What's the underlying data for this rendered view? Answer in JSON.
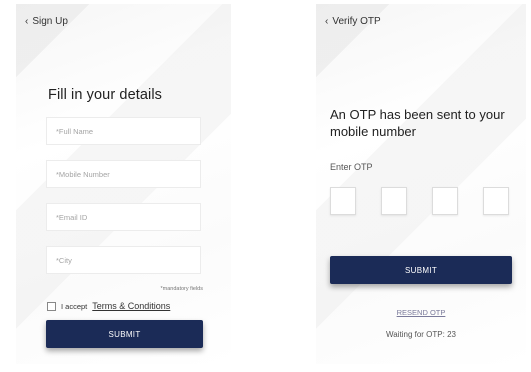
{
  "signup": {
    "back_label": "Sign Up",
    "title": "Fill in your details",
    "fields": {
      "full_name_placeholder": "*Full Name",
      "mobile_placeholder": "*Mobile Number",
      "email_placeholder": "*Email ID",
      "city_placeholder": "*City"
    },
    "mandatory_note": "*mandatory fields",
    "accept_text": "I accept",
    "terms_link": "Terms & Conditions",
    "submit_label": "SUBMIT"
  },
  "verify": {
    "back_label": "Verify OTP",
    "title": "An OTP has been sent to your mobile number",
    "enter_otp_label": "Enter OTP",
    "submit_label": "SUBMIT",
    "resend_label": "RESEND OTP",
    "waiting_text": "Waiting for OTP: 23"
  },
  "colors": {
    "primary_button": "#1b2b57"
  },
  "icons": {
    "back": "chevron-left-icon"
  }
}
